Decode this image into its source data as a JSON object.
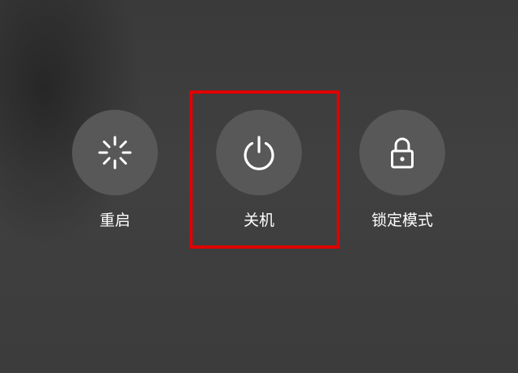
{
  "power_menu": {
    "options": [
      {
        "label": "重启",
        "icon": "restart-spinner-icon"
      },
      {
        "label": "关机",
        "icon": "power-icon"
      },
      {
        "label": "锁定模式",
        "icon": "padlock-icon"
      }
    ]
  },
  "colors": {
    "background": "#3d3d3d",
    "button_circle": "#585858",
    "text": "#ffffff",
    "highlight_border": "#e00000"
  }
}
